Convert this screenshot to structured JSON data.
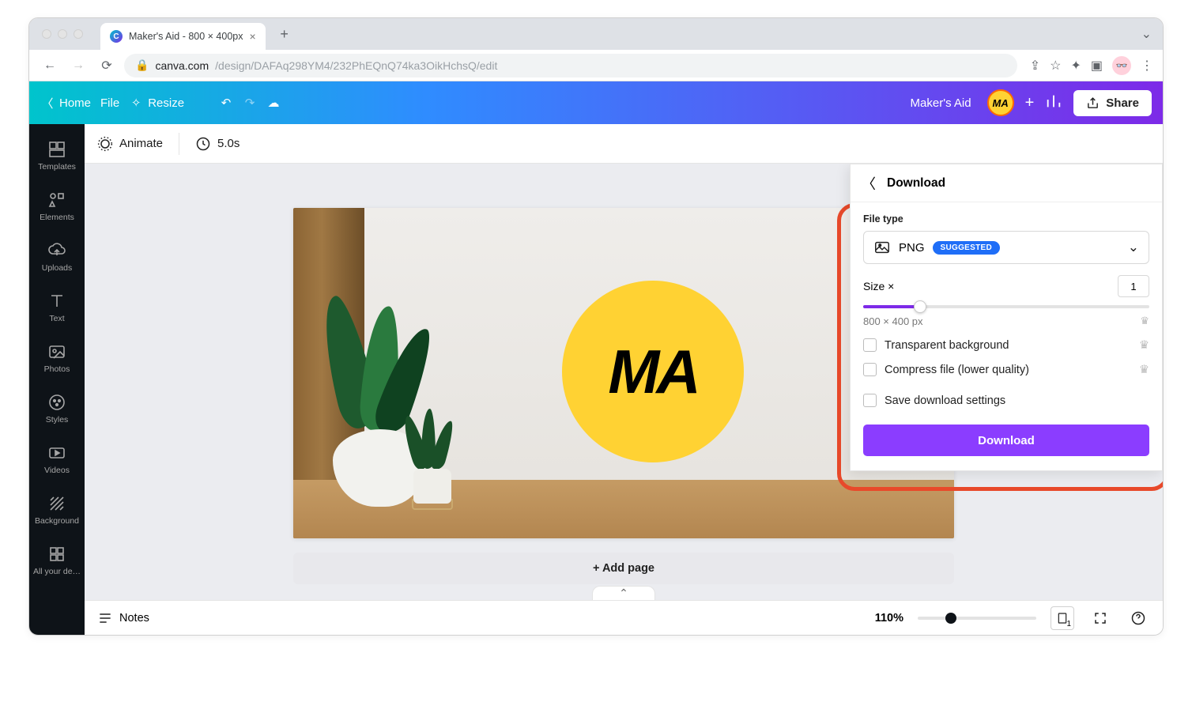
{
  "browser": {
    "tab_title": "Maker's Aid - 800 × 400px",
    "url_host": "canva.com",
    "url_path": "/design/DAFAq298YM4/232PhEQnQ74ka3OikHchsQ/edit"
  },
  "topbar": {
    "home": "Home",
    "file": "File",
    "resize": "Resize",
    "project_title": "Maker's Aid",
    "avatar_text": "MA",
    "share": "Share"
  },
  "sidebar": {
    "items": [
      {
        "label": "Templates"
      },
      {
        "label": "Elements"
      },
      {
        "label": "Uploads"
      },
      {
        "label": "Text"
      },
      {
        "label": "Photos"
      },
      {
        "label": "Styles"
      },
      {
        "label": "Videos"
      },
      {
        "label": "Background"
      },
      {
        "label": "All your de…"
      }
    ]
  },
  "contextbar": {
    "animate": "Animate",
    "duration": "5.0s"
  },
  "canvas": {
    "logo_text": "MA",
    "add_page": "+ Add page"
  },
  "download": {
    "title": "Download",
    "file_type_label": "File type",
    "selected_type": "PNG",
    "suggested_badge": "SUGGESTED",
    "size_label": "Size ×",
    "size_value": "1",
    "dimensions": "800 × 400 px",
    "opt_transparent": "Transparent background",
    "opt_compress": "Compress file (lower quality)",
    "opt_save": "Save download settings",
    "button": "Download"
  },
  "footer": {
    "notes": "Notes",
    "zoom": "110%",
    "page_count": "1"
  }
}
